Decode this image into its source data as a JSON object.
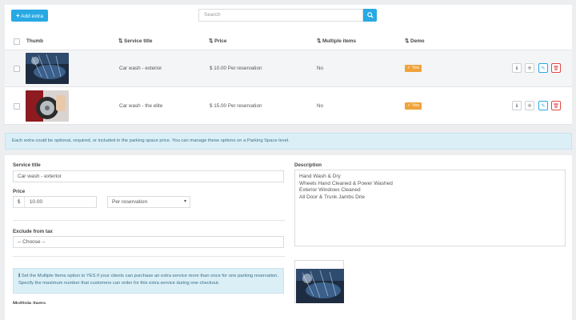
{
  "toolbar": {
    "add_label": "Add extra",
    "search_placeholder": "Search"
  },
  "table": {
    "headers": {
      "thumb": "Thumb",
      "title": "Service title",
      "price": "Price",
      "multiple": "Multiple items",
      "demo": "Demo"
    },
    "rows": [
      {
        "title": "Car wash - exterior",
        "price": "$ 10.00 Per reservation",
        "multiple": "No",
        "demo": "Yes"
      },
      {
        "title": "Car wash - the elite",
        "price": "$ 15.00 Per reservation",
        "multiple": "No",
        "demo": "Yes"
      }
    ]
  },
  "info_bar": "Each extra could be optional, required, or included in the parking space price. You can manage these options on a Parking Space level.",
  "form": {
    "service_title_label": "Service title",
    "service_title_value": "Car wash - exterior",
    "price_label": "Price",
    "currency": "$",
    "price_value": "10.00",
    "price_unit": "Per reservation",
    "exclude_tax_label": "Exclude from tax",
    "exclude_tax_value": "-- Choose --",
    "description_label": "Description",
    "description_lines": [
      "Hand Wash & Dry",
      "Wheels Hand Cleaned & Power Washed",
      "Exterior Windows Cleaned",
      "All Door & Trunk Jambs Drie"
    ],
    "multiple_note": "Set the Multiple Items option to YES if your clients can purchase an extra service more than once for one parking reservation. Specify the maximum number that customers can order for this extra service during one checkout.",
    "multiple_items_label": "Multiple items"
  },
  "colors": {
    "primary": "#27a9e3",
    "badge": "#f0a33c",
    "danger": "#e04848",
    "info_bg": "#dbeff7"
  }
}
